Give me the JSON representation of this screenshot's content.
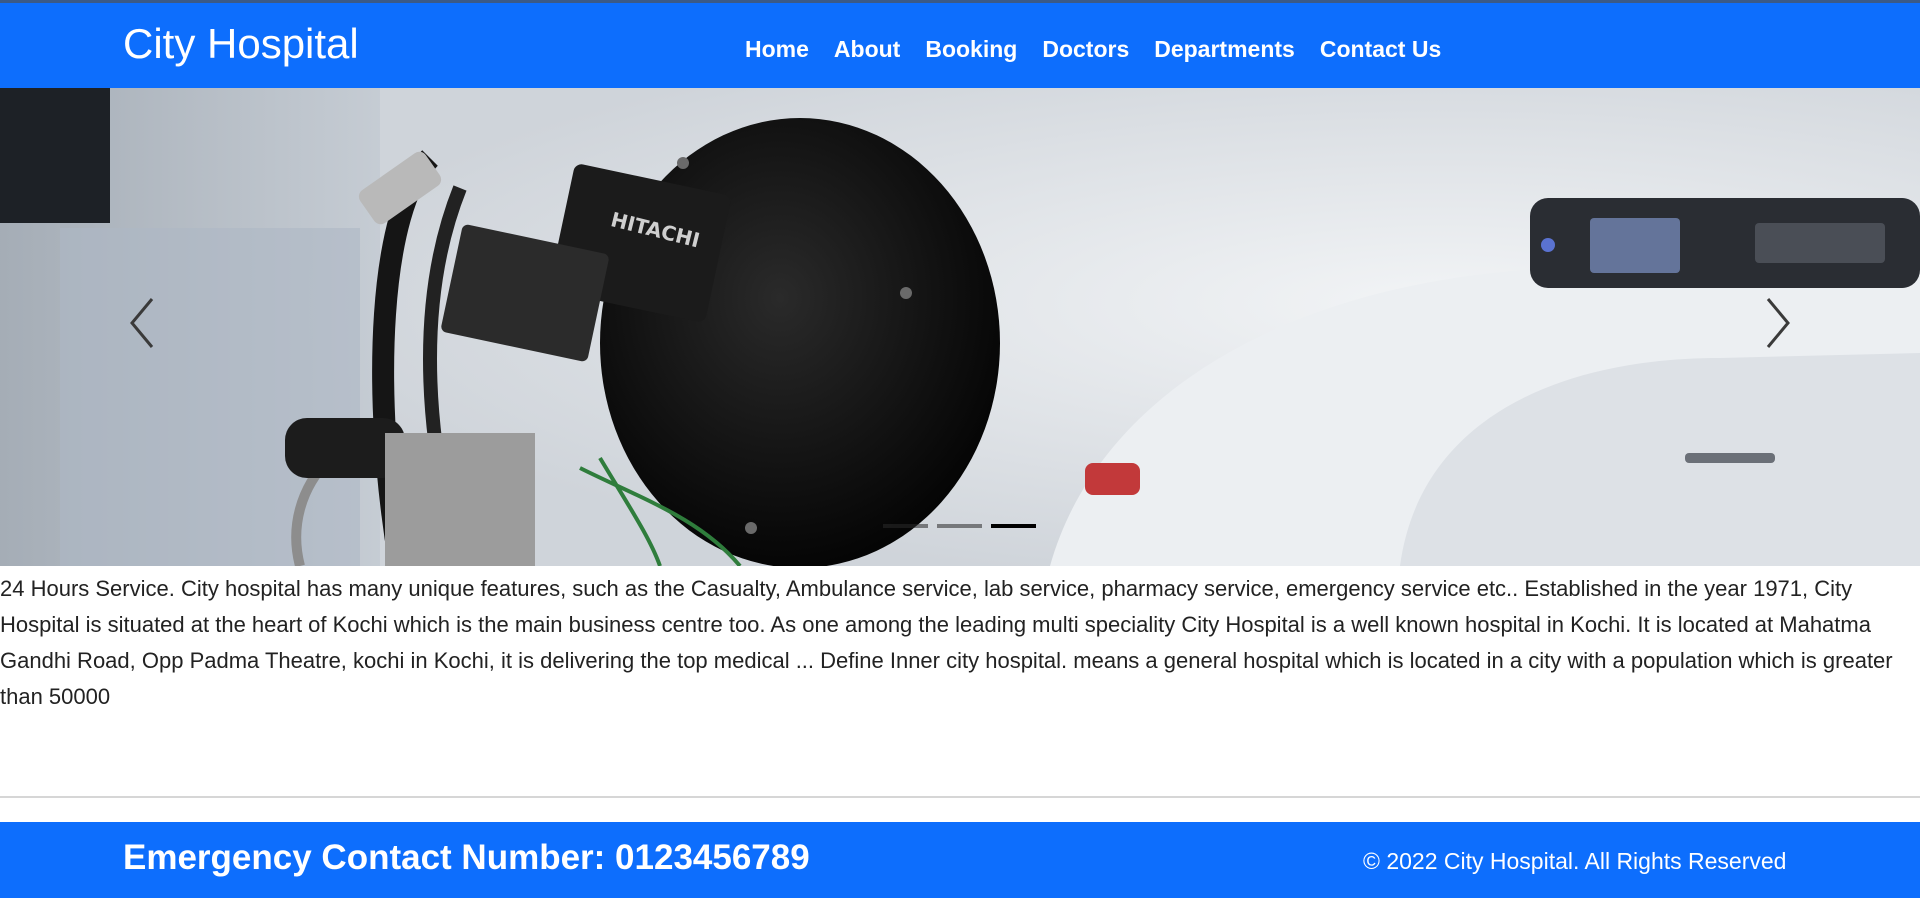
{
  "header": {
    "brand": "City Hospital",
    "nav": [
      "Home",
      "About",
      "Booking",
      "Doctors",
      "Departments",
      "Contact Us"
    ]
  },
  "carousel": {
    "image_subject": "CT scanner with HITACHI camera",
    "camera_label": "HITACHI",
    "prev_icon": "chevron-left-icon",
    "next_icon": "chevron-right-icon",
    "slide_count": 3,
    "active_slide": 3
  },
  "about": {
    "text": "24 Hours Service. City hospital has many unique features, such as the Casualty, Ambulance service, lab service, pharmacy service, emergency service etc.. Established in the year 1971, City Hospital is situated at the heart of Kochi which is the main business centre too. As one among the leading multi speciality City Hospital is a well known hospital in Kochi. It is located at Mahatma Gandhi Road, Opp Padma Theatre, kochi in Kochi, it is delivering the top medical ... Define Inner city hospital. means a general hospital which is located in a city with a population which is greater than 50000"
  },
  "footer": {
    "emergency": "Emergency Contact Number: 0123456789",
    "copyright": "© 2022 City Hospital. All Rights Reserved"
  },
  "colors": {
    "primary": "#0d6efd",
    "text": "#222222",
    "white": "#ffffff"
  }
}
